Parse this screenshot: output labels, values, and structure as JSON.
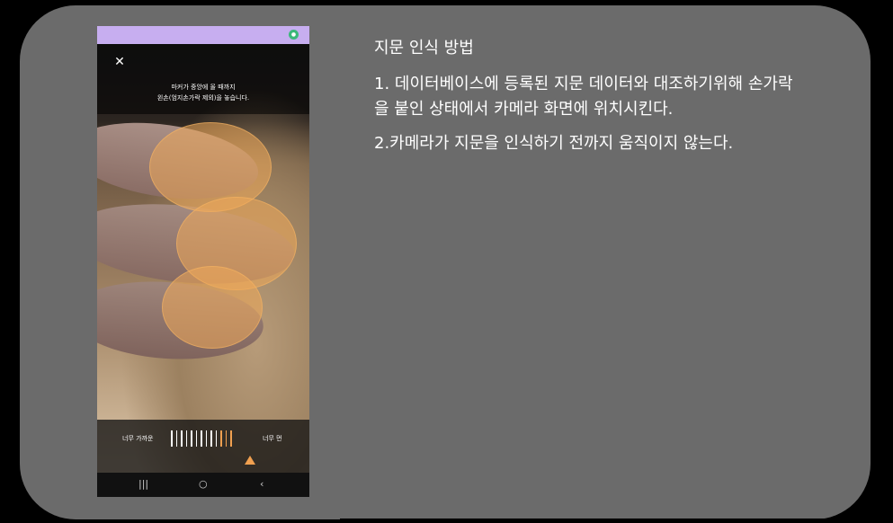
{
  "phone": {
    "status_icon": "camera-app-icon",
    "close_symbol": "✕",
    "instruction_line1": "마커가 중앙에 올 때까지",
    "instruction_line2": "왼손(엄지손가락 제외)을 놓습니다.",
    "distance": {
      "near_label": "너무 가까운",
      "far_label": "너무 먼"
    },
    "nav": {
      "recent": "|||",
      "home": "○",
      "back": "‹"
    },
    "colors": {
      "status_bar": "#c7aef0",
      "accent": "#f0a050"
    }
  },
  "panel": {
    "heading": "지문 인식 방법",
    "step1": "1. 데이터베이스에 등록된 지문 데이터와 대조하기위해 손가락을 붙인 상태에서 카메라 화면에 위치시킨다.",
    "step2": "2.카메라가 지문을 인식하기 전까지 움직이지 않는다."
  }
}
